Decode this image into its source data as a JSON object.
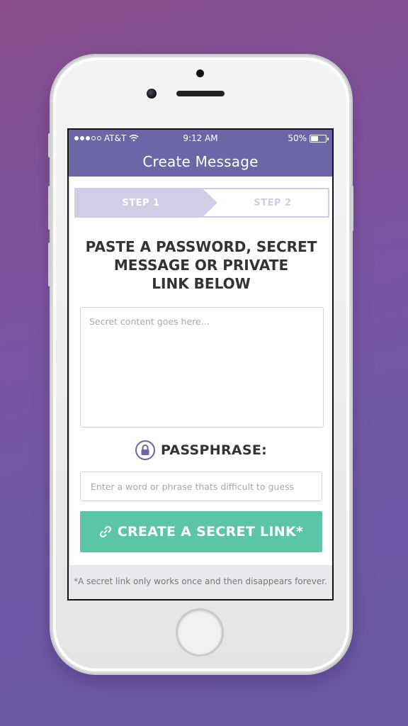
{
  "status_bar": {
    "carrier": "AT&T",
    "time": "9:12 AM",
    "battery": "50%"
  },
  "nav": {
    "title": "Create Message"
  },
  "steps": [
    {
      "label": "STEP 1",
      "active": true
    },
    {
      "label": "STEP 2",
      "active": false
    }
  ],
  "headline": {
    "line1": "PASTE A PASSWORD, SECRET",
    "line2": "MESSAGE OR PRIVATE",
    "line3": "LINK BELOW"
  },
  "secret_input": {
    "placeholder": "Secret content goes here..."
  },
  "passphrase": {
    "label": "PASSPHRASE:",
    "placeholder": "Enter a word or phrase thats difficult to guess"
  },
  "cta": {
    "label": "CREATE A SECRET LINK*"
  },
  "footnote": "*A secret link only works once and then disappears forever.",
  "colors": {
    "header": "#6b66a6",
    "step_active": "#cfcee6",
    "cta": "#5cc5a7"
  },
  "icons": {
    "lock": "lock-icon",
    "link": "link-icon",
    "wifi": "wifi-icon",
    "battery": "battery-icon"
  }
}
